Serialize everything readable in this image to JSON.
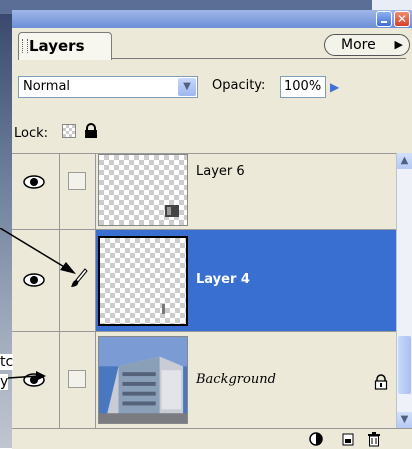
{
  "panel": {
    "tab_label": "Layers",
    "more_label": "More",
    "close_glyph": "✕"
  },
  "blend_mode": {
    "value": "Normal"
  },
  "opacity": {
    "label": "Opacity:",
    "value": "100%"
  },
  "lock": {
    "label": "Lock:"
  },
  "layers": [
    {
      "name": "Layer 6",
      "visible": true,
      "selected": false
    },
    {
      "name": "Layer 4",
      "visible": true,
      "selected": true
    },
    {
      "name": "Background",
      "visible": true,
      "selected": false,
      "locked": true
    }
  ],
  "cropped_side_text": {
    "line1": "tc",
    "line2": "y"
  },
  "colors": {
    "selection": "#3a6fd2",
    "panel_bg": "#ece9d8",
    "title_bar": "#7d9be0"
  },
  "icons": [
    "minimize-icon",
    "close-icon",
    "more-arrow-icon",
    "dropdown-arrow-icon",
    "lock-transparency-icon",
    "lock-all-icon",
    "eye-icon",
    "brush-icon",
    "padlock-icon",
    "adjustment-layer-icon",
    "new-layer-icon",
    "trash-icon"
  ]
}
